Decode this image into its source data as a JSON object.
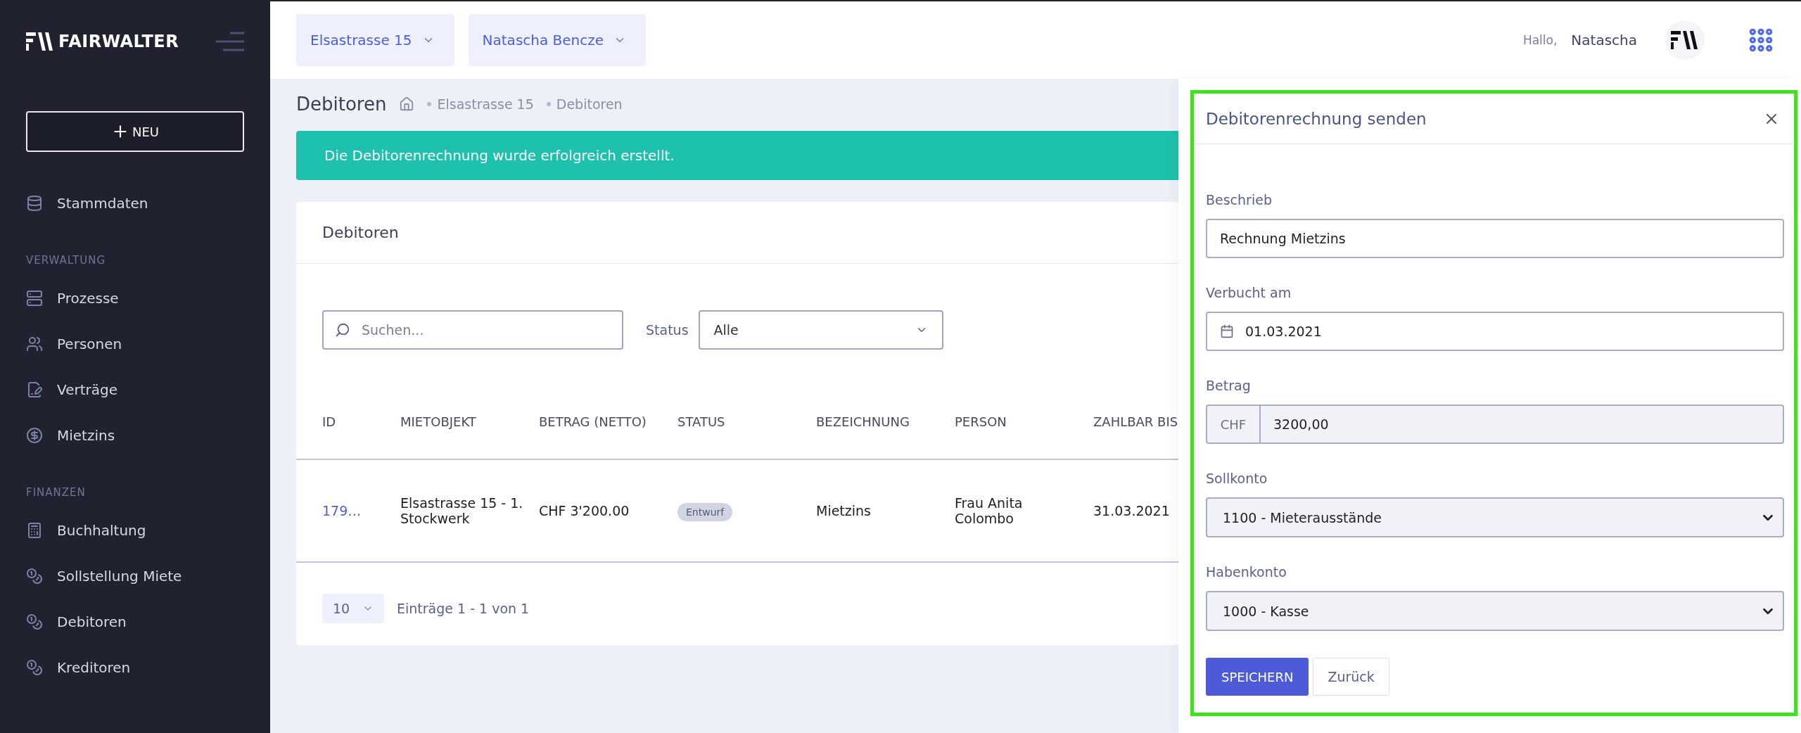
{
  "sidebar": {
    "logo": "FAIRWALTER",
    "new_button": "NEU",
    "top_items": [
      {
        "label": "Stammdaten",
        "kind": "database"
      }
    ],
    "sections": [
      {
        "heading": "VERWALTUNG",
        "items": [
          {
            "label": "Prozesse",
            "kind": "server"
          },
          {
            "label": "Personen",
            "kind": "people"
          },
          {
            "label": "Verträge",
            "kind": "contract"
          },
          {
            "label": "Mietzins",
            "kind": "coin"
          }
        ]
      },
      {
        "heading": "FINANZEN",
        "items": [
          {
            "label": "Buchhaltung",
            "kind": "calculator"
          },
          {
            "label": "Sollstellung Miete",
            "kind": "coins"
          },
          {
            "label": "Debitoren",
            "kind": "coins"
          },
          {
            "label": "Kreditoren",
            "kind": "coins"
          }
        ]
      }
    ]
  },
  "header": {
    "selectors": [
      {
        "label": "Elsastrasse 15"
      },
      {
        "label": "Natascha Bencze"
      }
    ],
    "greeting": "Hallo,",
    "user": "Natascha"
  },
  "page": {
    "title": "Debitoren",
    "breadcrumb": [
      "Elsastrasse 15",
      "Debitoren"
    ],
    "alert": "Die Debitorenrechnung wurde erfolgreich erstellt."
  },
  "card": {
    "title": "Debitoren",
    "search": {
      "placeholder": "Suchen..."
    },
    "status_filter": {
      "label": "Status",
      "value": "Alle"
    },
    "columns": [
      "ID",
      "MIETOBJEKT",
      "BETRAG (NETTO)",
      "STATUS",
      "BEZEICHNUNG",
      "PERSON",
      "ZAHLBAR BIS"
    ],
    "rows": [
      {
        "id": "179…",
        "mietobjekt": "Elsastrasse 15 - 1. Stockwerk",
        "betrag": "CHF 3'200.00",
        "status": "Entwurf",
        "bezeichnung": "Mietzins",
        "person": "Frau Anita Colombo",
        "zahlbar_bis": "31.03.2021"
      }
    ],
    "page_size": "10",
    "info": "Einträge 1 - 1 von 1"
  },
  "panel": {
    "title": "Debitorenrechnung senden",
    "fields": [
      {
        "kind": "text",
        "label": "Beschrieb",
        "value": "Rechnung Mietzins"
      },
      {
        "kind": "date",
        "label": "Verbucht am",
        "value": "01.03.2021"
      },
      {
        "kind": "currency",
        "label": "Betrag",
        "prefix": "CHF",
        "value": "3200,00"
      },
      {
        "kind": "select",
        "label": "Sollkonto",
        "value": "1100 - Mieterausstände"
      },
      {
        "kind": "select",
        "label": "Habenkonto",
        "value": "1000 - Kasse"
      }
    ],
    "save_button": "SPEICHERN",
    "back_button": "Zurück"
  }
}
